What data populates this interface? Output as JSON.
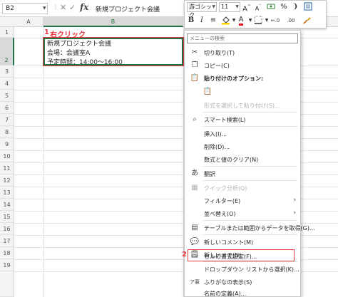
{
  "formula_bar": {
    "name_box": "B2",
    "fx_label": "fx",
    "cancel": "✕",
    "confirm": "✓",
    "content": "新規プロジェクト会議"
  },
  "columns": [
    "A",
    "B"
  ],
  "rows": [
    "1",
    "2",
    "3",
    "4",
    "5",
    "6",
    "7",
    "8",
    "9",
    "10",
    "11",
    "12",
    "13",
    "14",
    "15",
    "16",
    "17",
    "18",
    "19"
  ],
  "cell_b2": {
    "lines": [
      "新規プロジェクト会議",
      "会場：会議室A",
      "予定時間：14:00～16:00"
    ]
  },
  "annotations": {
    "step1_num": "1",
    "step1_label": "右クリック",
    "step2_num": "2"
  },
  "mini_toolbar": {
    "font_name": "游ゴシック",
    "font_size": "11",
    "grow": "A",
    "shrink": "A",
    "currency": "",
    "percent": "%",
    "comma": "",
    "bold": "B",
    "italic": "I",
    "align": "≡",
    "fill": "",
    "font_color": "A",
    "borders": "",
    "decrease_dec": "",
    "increase_dec": "",
    "format_painter": ""
  },
  "context_menu": {
    "search_placeholder": "メニューの検索",
    "items": {
      "cut": "切り取り(T)",
      "copy": "コピー(C)",
      "paste_options": "貼り付けのオプション:",
      "paste_special": "形式を選択して貼り付け(S)...",
      "smart_lookup": "スマート検索(L)",
      "insert": "挿入(I)...",
      "delete": "削除(D)...",
      "clear": "数式と値のクリア(N)",
      "translate": "翻訳",
      "quick_analysis": "クイック分析(Q)",
      "filter": "フィルター(E)",
      "sort": "並べ替え(O)",
      "table_range": "テーブルまたは範囲からデータを取得(G)...",
      "new_comment": "新しいコメント(M)",
      "new_note": "新しいメモ(N)",
      "format_cells": "セルの書式設定(F)...",
      "dropdown": "ドロップダウン リストから選択(K)...",
      "phonetic": "ふりがなの表示(S)",
      "define_name": "名前の定義(A)..."
    }
  },
  "colors": {
    "accent_green": "#217346",
    "callout_red": "#e8383d"
  }
}
